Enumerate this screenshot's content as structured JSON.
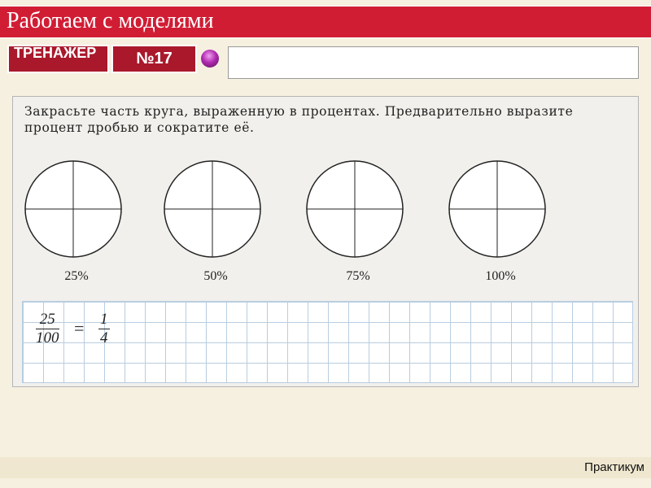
{
  "header": {
    "title": "Работаем с моделями"
  },
  "toolbar": {
    "trainer_label": "ТРЕНАЖЕР",
    "number_label": "№17",
    "answer_value": ""
  },
  "task": {
    "text": "Закрасьте часть круга, выраженную в процентах. Предварительно выразите процент дробью и сократите её.",
    "circles": [
      {
        "label": "25%"
      },
      {
        "label": "50%"
      },
      {
        "label": "75%"
      },
      {
        "label": "100%"
      }
    ],
    "example": {
      "numerator": "25",
      "denominator": "100",
      "equals": "=",
      "result_numerator": "1",
      "result_denominator": "4"
    }
  },
  "footer": {
    "label": "Практикум"
  }
}
